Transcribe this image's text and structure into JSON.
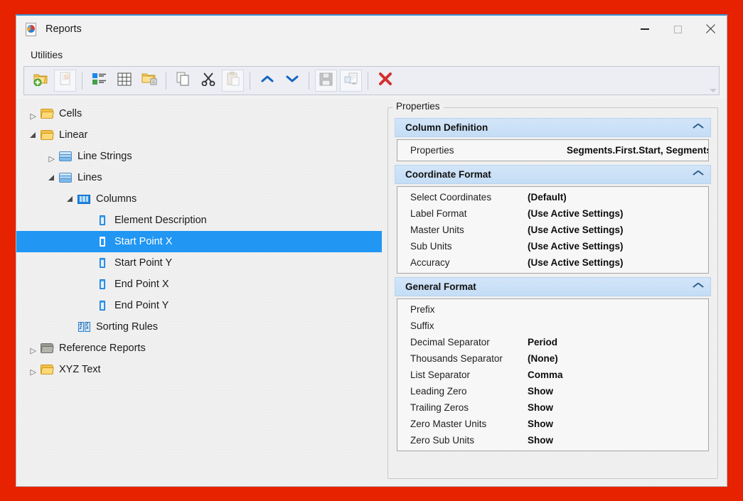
{
  "window": {
    "title": "Reports",
    "app_icon": "report-document-icon",
    "minimize_label": "Minimize",
    "maximize_label": "Maximize",
    "close_label": "Close"
  },
  "menubar": {
    "items": [
      {
        "label": "Utilities",
        "name": "menu-utilities"
      }
    ]
  },
  "toolbar": {
    "overflow_label": "More toolbar commands",
    "buttons": [
      {
        "name": "new-report-folder-button",
        "icon": "folder-add-icon",
        "enabled": true,
        "framed": false
      },
      {
        "name": "new-report-button",
        "icon": "report-new-icon",
        "enabled": false,
        "framed": true
      },
      {
        "name": "list-view-button",
        "icon": "list-icon",
        "enabled": true,
        "framed": false
      },
      {
        "name": "table-view-button",
        "icon": "table-grid-icon",
        "enabled": true,
        "framed": false
      },
      {
        "name": "folder-link-button",
        "icon": "folder-link-icon",
        "enabled": true,
        "framed": false
      },
      {
        "name": "copy-button",
        "icon": "copy-icon",
        "enabled": true,
        "framed": false
      },
      {
        "name": "cut-button",
        "icon": "scissors-icon",
        "enabled": true,
        "framed": false
      },
      {
        "name": "paste-button",
        "icon": "clipboard-paste-icon",
        "enabled": false,
        "framed": true
      },
      {
        "name": "move-up-button",
        "icon": "chevron-up-icon",
        "enabled": true,
        "framed": false
      },
      {
        "name": "move-down-button",
        "icon": "chevron-down-icon",
        "enabled": true,
        "framed": false
      },
      {
        "name": "save-button",
        "icon": "floppy-save-icon",
        "enabled": false,
        "framed": true
      },
      {
        "name": "save-as-button",
        "icon": "export-document-icon",
        "enabled": false,
        "framed": true
      },
      {
        "name": "delete-button",
        "icon": "red-x-icon",
        "enabled": true,
        "framed": false
      }
    ]
  },
  "tree": {
    "nodes": [
      {
        "label": "Cells",
        "indent": 0,
        "twisty": "collapsed",
        "icon": "folder-icon",
        "selected": false
      },
      {
        "label": "Linear",
        "indent": 0,
        "twisty": "expanded",
        "icon": "folder-icon",
        "selected": false
      },
      {
        "label": "Line Strings",
        "indent": 1,
        "twisty": "collapsed",
        "icon": "layers-icon",
        "selected": false
      },
      {
        "label": "Lines",
        "indent": 1,
        "twisty": "expanded",
        "icon": "layers-icon",
        "selected": false
      },
      {
        "label": "Columns",
        "indent": 2,
        "twisty": "expanded",
        "icon": "columns-grid-icon",
        "selected": false
      },
      {
        "label": "Element Description",
        "indent": 3,
        "twisty": "none",
        "icon": "column-icon",
        "selected": false
      },
      {
        "label": "Start Point X",
        "indent": 3,
        "twisty": "none",
        "icon": "column-icon",
        "selected": true
      },
      {
        "label": "Start Point Y",
        "indent": 3,
        "twisty": "none",
        "icon": "column-icon",
        "selected": false
      },
      {
        "label": "End Point X",
        "indent": 3,
        "twisty": "none",
        "icon": "column-icon",
        "selected": false
      },
      {
        "label": "End Point Y",
        "indent": 3,
        "twisty": "none",
        "icon": "column-icon",
        "selected": false
      },
      {
        "label": "Sorting Rules",
        "indent": 2,
        "twisty": "none",
        "icon": "sorting-rules-icon",
        "selected": false
      },
      {
        "label": "Reference Reports",
        "indent": 0,
        "twisty": "collapsed",
        "icon": "folder-gray-icon",
        "selected": false
      },
      {
        "label": "XYZ Text",
        "indent": 0,
        "twisty": "collapsed",
        "icon": "folder-icon",
        "selected": false
      }
    ],
    "selection_color": "#2196f3"
  },
  "properties": {
    "legend": "Properties",
    "sections": [
      {
        "title": "Column Definition",
        "expanded": true,
        "rows": [
          {
            "name": "Properties",
            "value": "Segments.First.Start, Segments.Fi"
          }
        ]
      },
      {
        "title": "Coordinate Format",
        "expanded": true,
        "rows": [
          {
            "name": "Select Coordinates",
            "value": "(Default)"
          },
          {
            "name": "Label Format",
            "value": "(Use Active Settings)"
          },
          {
            "name": "Master Units",
            "value": "(Use Active Settings)"
          },
          {
            "name": "Sub Units",
            "value": "(Use Active Settings)"
          },
          {
            "name": "Accuracy",
            "value": "(Use Active Settings)"
          }
        ]
      },
      {
        "title": "General Format",
        "expanded": true,
        "rows": [
          {
            "name": "Prefix",
            "value": ""
          },
          {
            "name": "Suffix",
            "value": ""
          },
          {
            "name": "Decimal Separator",
            "value": "Period"
          },
          {
            "name": "Thousands Separator",
            "value": "(None)"
          },
          {
            "name": "List Separator",
            "value": "Comma"
          },
          {
            "name": "Leading Zero",
            "value": "Show"
          },
          {
            "name": "Trailing Zeros",
            "value": "Show"
          },
          {
            "name": "Zero Master Units",
            "value": "Show"
          },
          {
            "name": "Zero Sub Units",
            "value": "Show"
          }
        ]
      }
    ]
  },
  "colors": {
    "desktop_background": "#e62200",
    "window_accent": "#3b8fd4",
    "section_header": "#c9dff5",
    "selection": "#2196f3",
    "delete_icon": "#d32f2f"
  }
}
